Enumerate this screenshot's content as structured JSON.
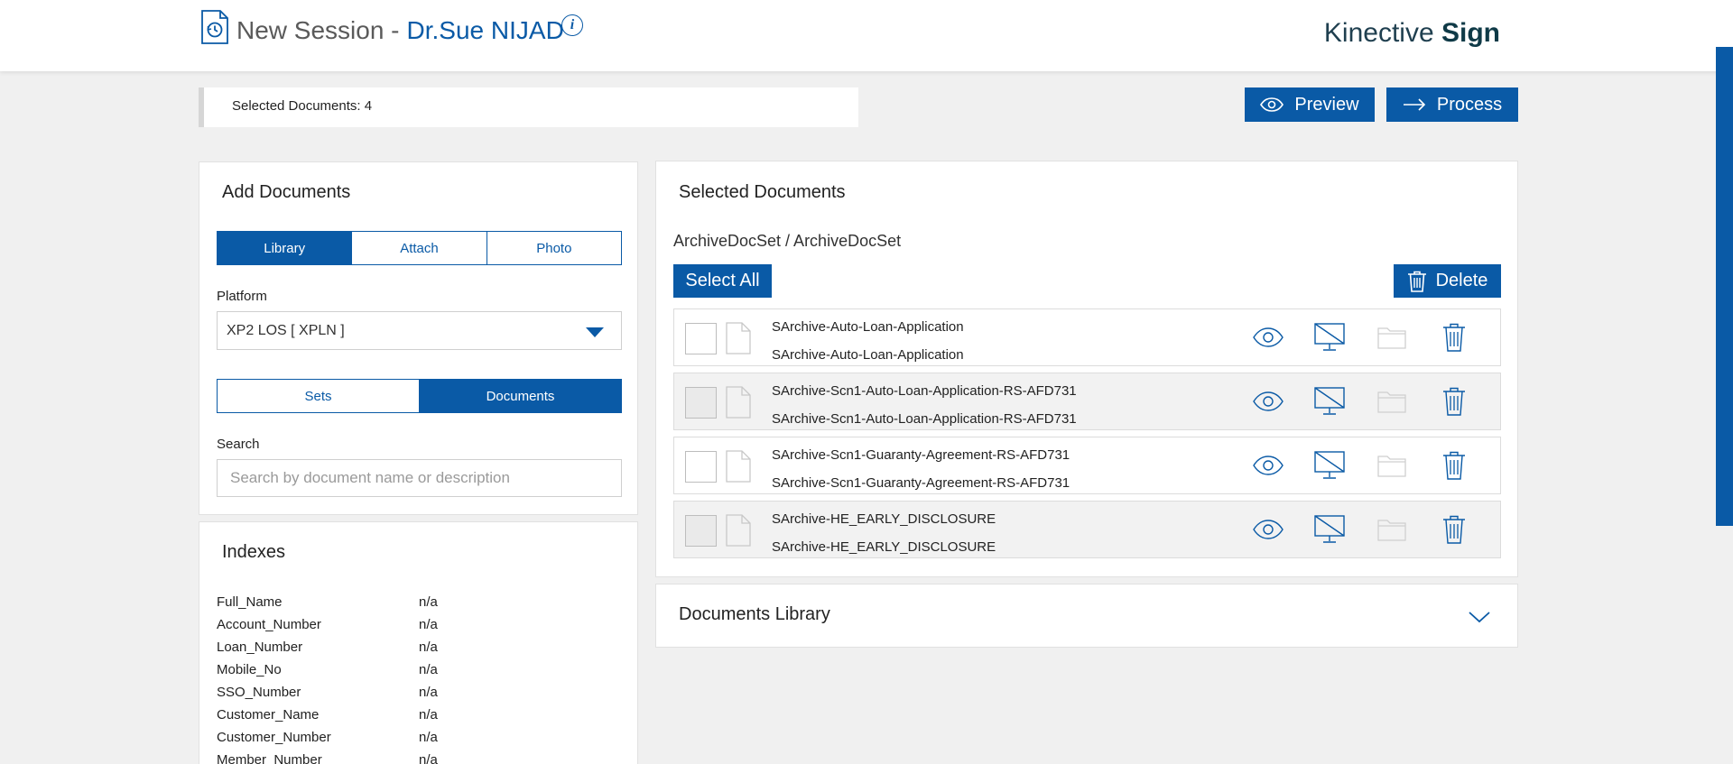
{
  "header": {
    "title_prefix": "New Session -",
    "doctor_name": "Dr.Sue NIJAD",
    "info_symbol": "i",
    "brand_light": "Kinective",
    "brand_bold": "Sign",
    "session_icon": "document-history-icon"
  },
  "toolbar": {
    "selected_count_label": "Selected Documents: 4",
    "preview_label": "Preview",
    "process_label": "Process"
  },
  "add_documents": {
    "title": "Add Documents",
    "tabs": [
      {
        "label": "Library",
        "active": true
      },
      {
        "label": "Attach",
        "active": false
      },
      {
        "label": "Photo",
        "active": false
      }
    ],
    "platform_label": "Platform",
    "platform_value": "XP2 LOS [ XPLN ]",
    "type_toggle": [
      {
        "label": "Sets",
        "active": false
      },
      {
        "label": "Documents",
        "active": true
      }
    ],
    "search_label": "Search",
    "search_placeholder": "Search by document name or description",
    "search_value": ""
  },
  "indexes": {
    "title": "Indexes",
    "rows": [
      {
        "key": "Full_Name",
        "value": "n/a"
      },
      {
        "key": "Account_Number",
        "value": "n/a"
      },
      {
        "key": "Loan_Number",
        "value": "n/a"
      },
      {
        "key": "Mobile_No",
        "value": "n/a"
      },
      {
        "key": "SSO_Number",
        "value": "n/a"
      },
      {
        "key": "Customer_Name",
        "value": "n/a"
      },
      {
        "key": "Customer_Number",
        "value": "n/a"
      },
      {
        "key": "Member_Number",
        "value": "n/a"
      }
    ]
  },
  "selected_documents": {
    "title": "Selected Documents",
    "docset_path": "ArchiveDocSet / ArchiveDocSet",
    "select_all_label": "Select All",
    "delete_label": "Delete",
    "rows": [
      {
        "name": "SArchive-Auto-Loan-Application",
        "description": "SArchive-Auto-Loan-Application",
        "checked": false
      },
      {
        "name": "SArchive-Scn1-Auto-Loan-Application-RS-AFD731",
        "description": "SArchive-Scn1-Auto-Loan-Application-RS-AFD731",
        "checked": false
      },
      {
        "name": "SArchive-Scn1-Guaranty-Agreement-RS-AFD731",
        "description": "SArchive-Scn1-Guaranty-Agreement-RS-AFD731",
        "checked": false
      },
      {
        "name": "SArchive-HE_EARLY_DISCLOSURE",
        "description": "SArchive-HE_EARLY_DISCLOSURE",
        "checked": false
      }
    ]
  },
  "documents_library": {
    "title": "Documents Library"
  },
  "colors": {
    "accent": "#0a5aa6",
    "background": "#f0f0f0",
    "brand_text": "#0f3a47"
  }
}
